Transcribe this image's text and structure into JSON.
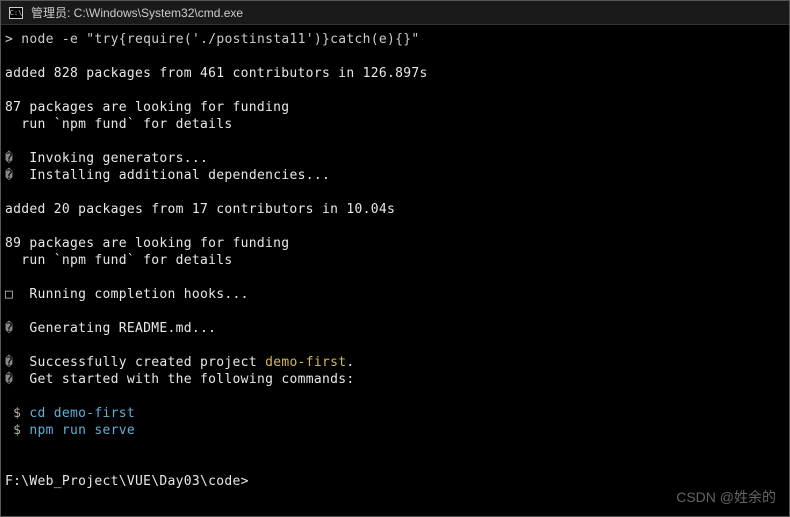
{
  "titlebar": {
    "icon_label": "C:\\",
    "title": "管理员: C:\\Windows\\System32\\cmd.exe"
  },
  "terminal": {
    "line_cmd_prompt": ">",
    "line_cmd": "node -e \"try{require('./postinsta11')}catch(e){}\"",
    "line_added1": "added 828 packages from 461 contributors in 126.897s",
    "line_funding1_a": "87 packages are looking for funding",
    "line_funding1_b": "  run `npm fund` for details",
    "line_invoke": "  Invoking generators...",
    "line_install": "  Installing additional dependencies...",
    "line_added2": "added 20 packages from 17 contributors in 10.04s",
    "line_funding2_a": "89 packages are looking for funding",
    "line_funding2_b": "  run `npm fund` for details",
    "line_hooks": "  Running completion hooks...",
    "line_readme": "  Generating README.md...",
    "line_success_a": "  Successfully created project ",
    "line_success_b": "demo-first",
    "line_success_c": ".",
    "line_getstarted": "  Get started with the following commands:",
    "line_cd_prompt": " $ ",
    "line_cd": "cd demo-first",
    "line_serve_prompt": " $ ",
    "line_serve": "npm run serve",
    "line_path": "F:\\Web_Project\\VUE\\Day03\\code>",
    "diamond": "�"
  },
  "watermark": "CSDN @姓余的"
}
